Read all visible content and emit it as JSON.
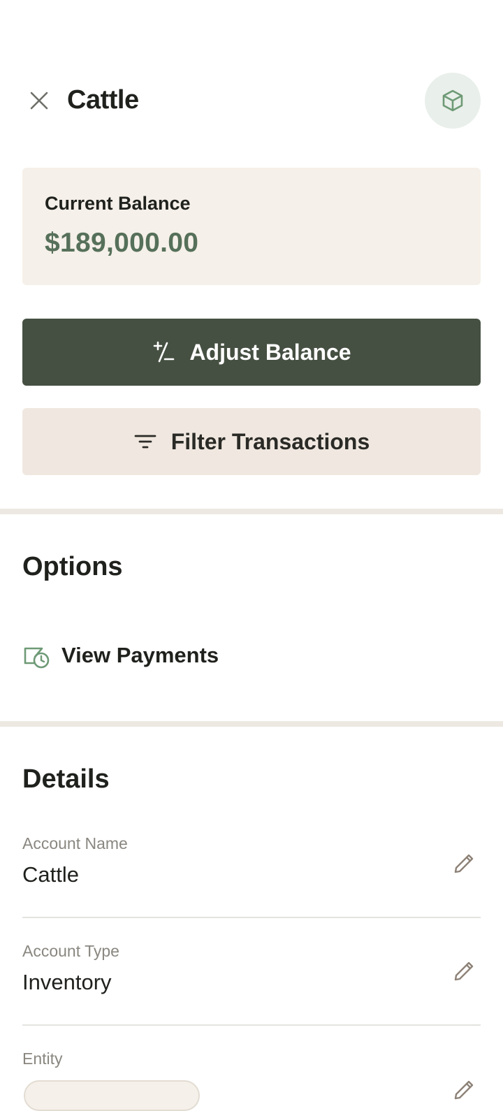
{
  "header": {
    "title": "Cattle",
    "close_icon": "close-icon",
    "account_icon": "cube-icon"
  },
  "balance": {
    "label": "Current Balance",
    "value": "$189,000.00"
  },
  "actions": {
    "adjust_label": "Adjust Balance",
    "adjust_icon": "plus-minus-icon",
    "filter_label": "Filter Transactions",
    "filter_icon": "filter-icon"
  },
  "options": {
    "title": "Options",
    "items": [
      {
        "label": "View Payments",
        "icon": "payment-history-icon"
      }
    ]
  },
  "details": {
    "title": "Details",
    "fields": [
      {
        "label": "Account Name",
        "value": "Cattle"
      },
      {
        "label": "Account Type",
        "value": "Inventory"
      },
      {
        "label": "Entity",
        "value": ""
      }
    ]
  },
  "colors": {
    "primary_button": "#465042",
    "secondary_button": "#f0e8e0",
    "balance_card": "#f5f0e9",
    "balance_value": "#56705a",
    "icon_accent": "#6e9a76"
  }
}
